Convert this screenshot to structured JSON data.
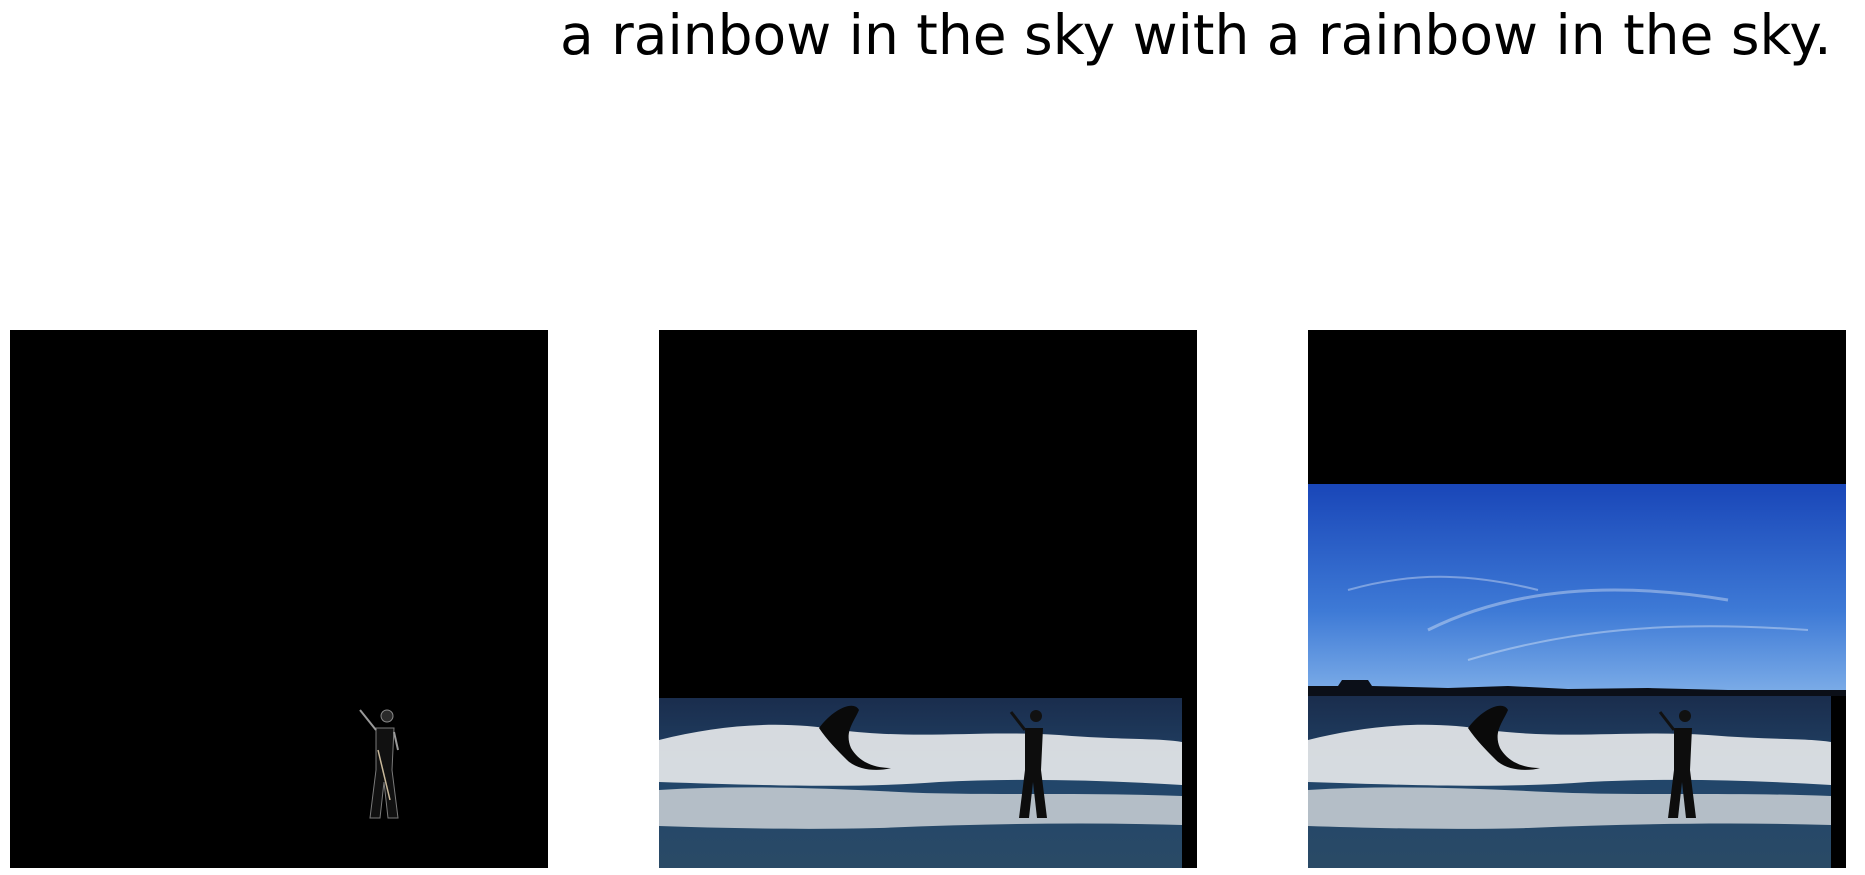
{
  "caption": "a rainbow in the sky with a rainbow in the sky.",
  "panels": [
    {
      "name": "figure-only",
      "description_hidden": true
    },
    {
      "name": "figure-and-sea"
    },
    {
      "name": "full-scene"
    }
  ],
  "colors": {
    "background": "#000000",
    "sky_top": "#1e4fc0",
    "sky_bottom": "#6aa0e8",
    "sea": "#17304f",
    "foam": "#e6e8ea"
  }
}
